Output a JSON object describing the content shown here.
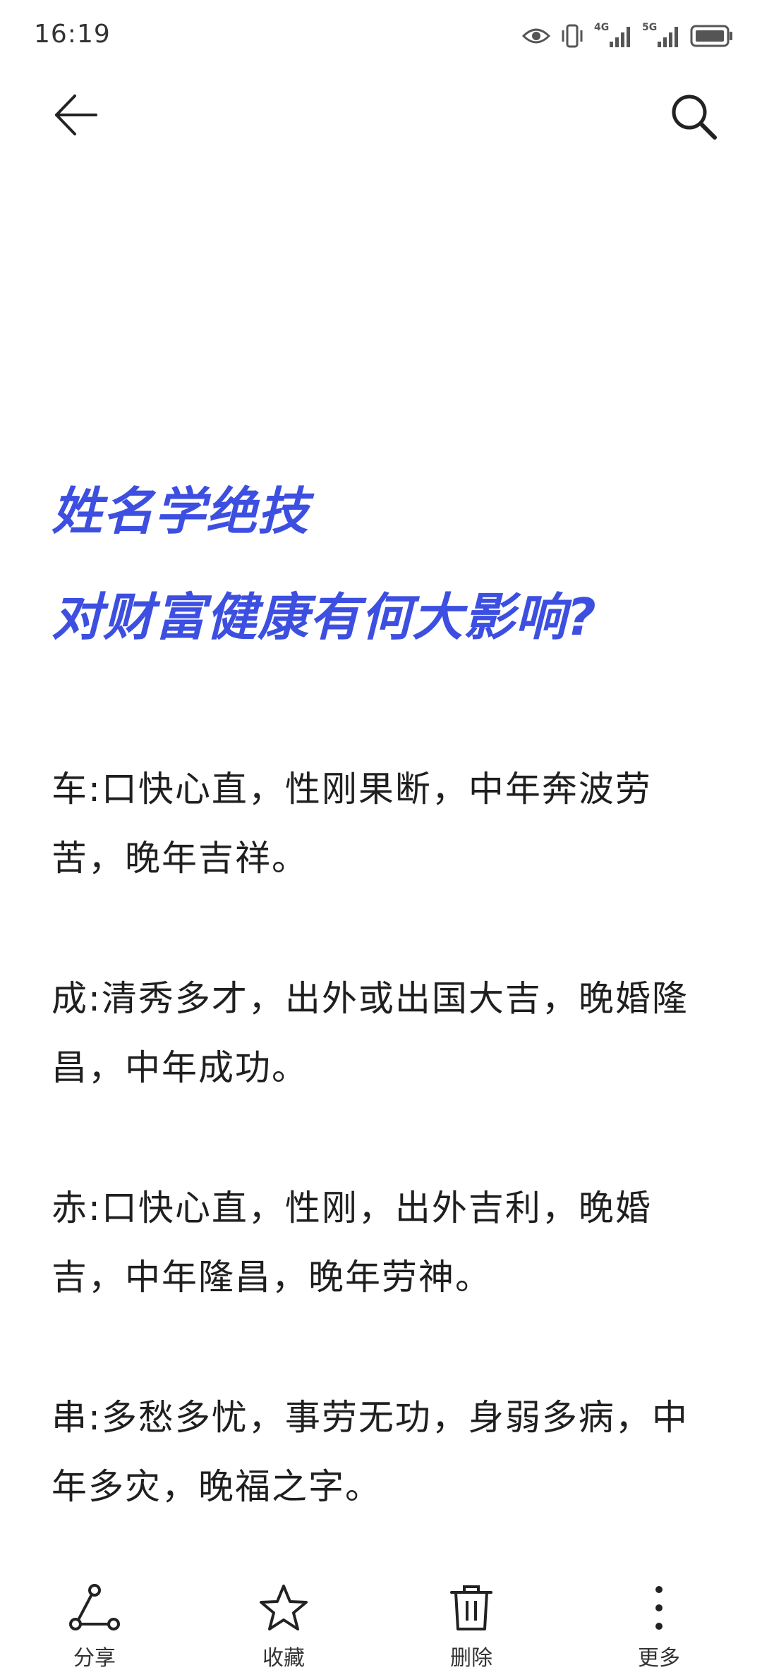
{
  "status_bar": {
    "time": "16:19",
    "network_1": "4G",
    "network_2": "5G",
    "icons": [
      "eye-icon",
      "vibrate-icon",
      "signal-4g-icon",
      "signal-5g-icon",
      "battery-icon"
    ]
  },
  "app_bar": {
    "back_icon": "arrow-left-icon",
    "search_icon": "search-icon"
  },
  "article": {
    "title_lines": [
      "姓名学绝技",
      "对财富健康有何大影响?"
    ],
    "paragraphs": [
      "车:口快心直，性刚果断，中年奔波劳苦，晚年吉祥。",
      "成:清秀多才，出外或出国大吉，晚婚隆昌，中年成功。",
      "赤:口快心直，性刚，出外吉利，晚婚吉，中年隆昌，晚年劳神。",
      "串:多愁多忧，事劳无功，身弱多病，中年多灾，晚福之字。"
    ]
  },
  "bottom_bar": {
    "items": [
      {
        "label": "分享",
        "icon": "share-icon"
      },
      {
        "label": "收藏",
        "icon": "star-icon"
      },
      {
        "label": "删除",
        "icon": "trash-icon"
      },
      {
        "label": "更多",
        "icon": "more-vertical-icon"
      }
    ]
  },
  "colors": {
    "title": "#3d4fe0",
    "text": "#1f1f1f",
    "background": "#ffffff"
  }
}
